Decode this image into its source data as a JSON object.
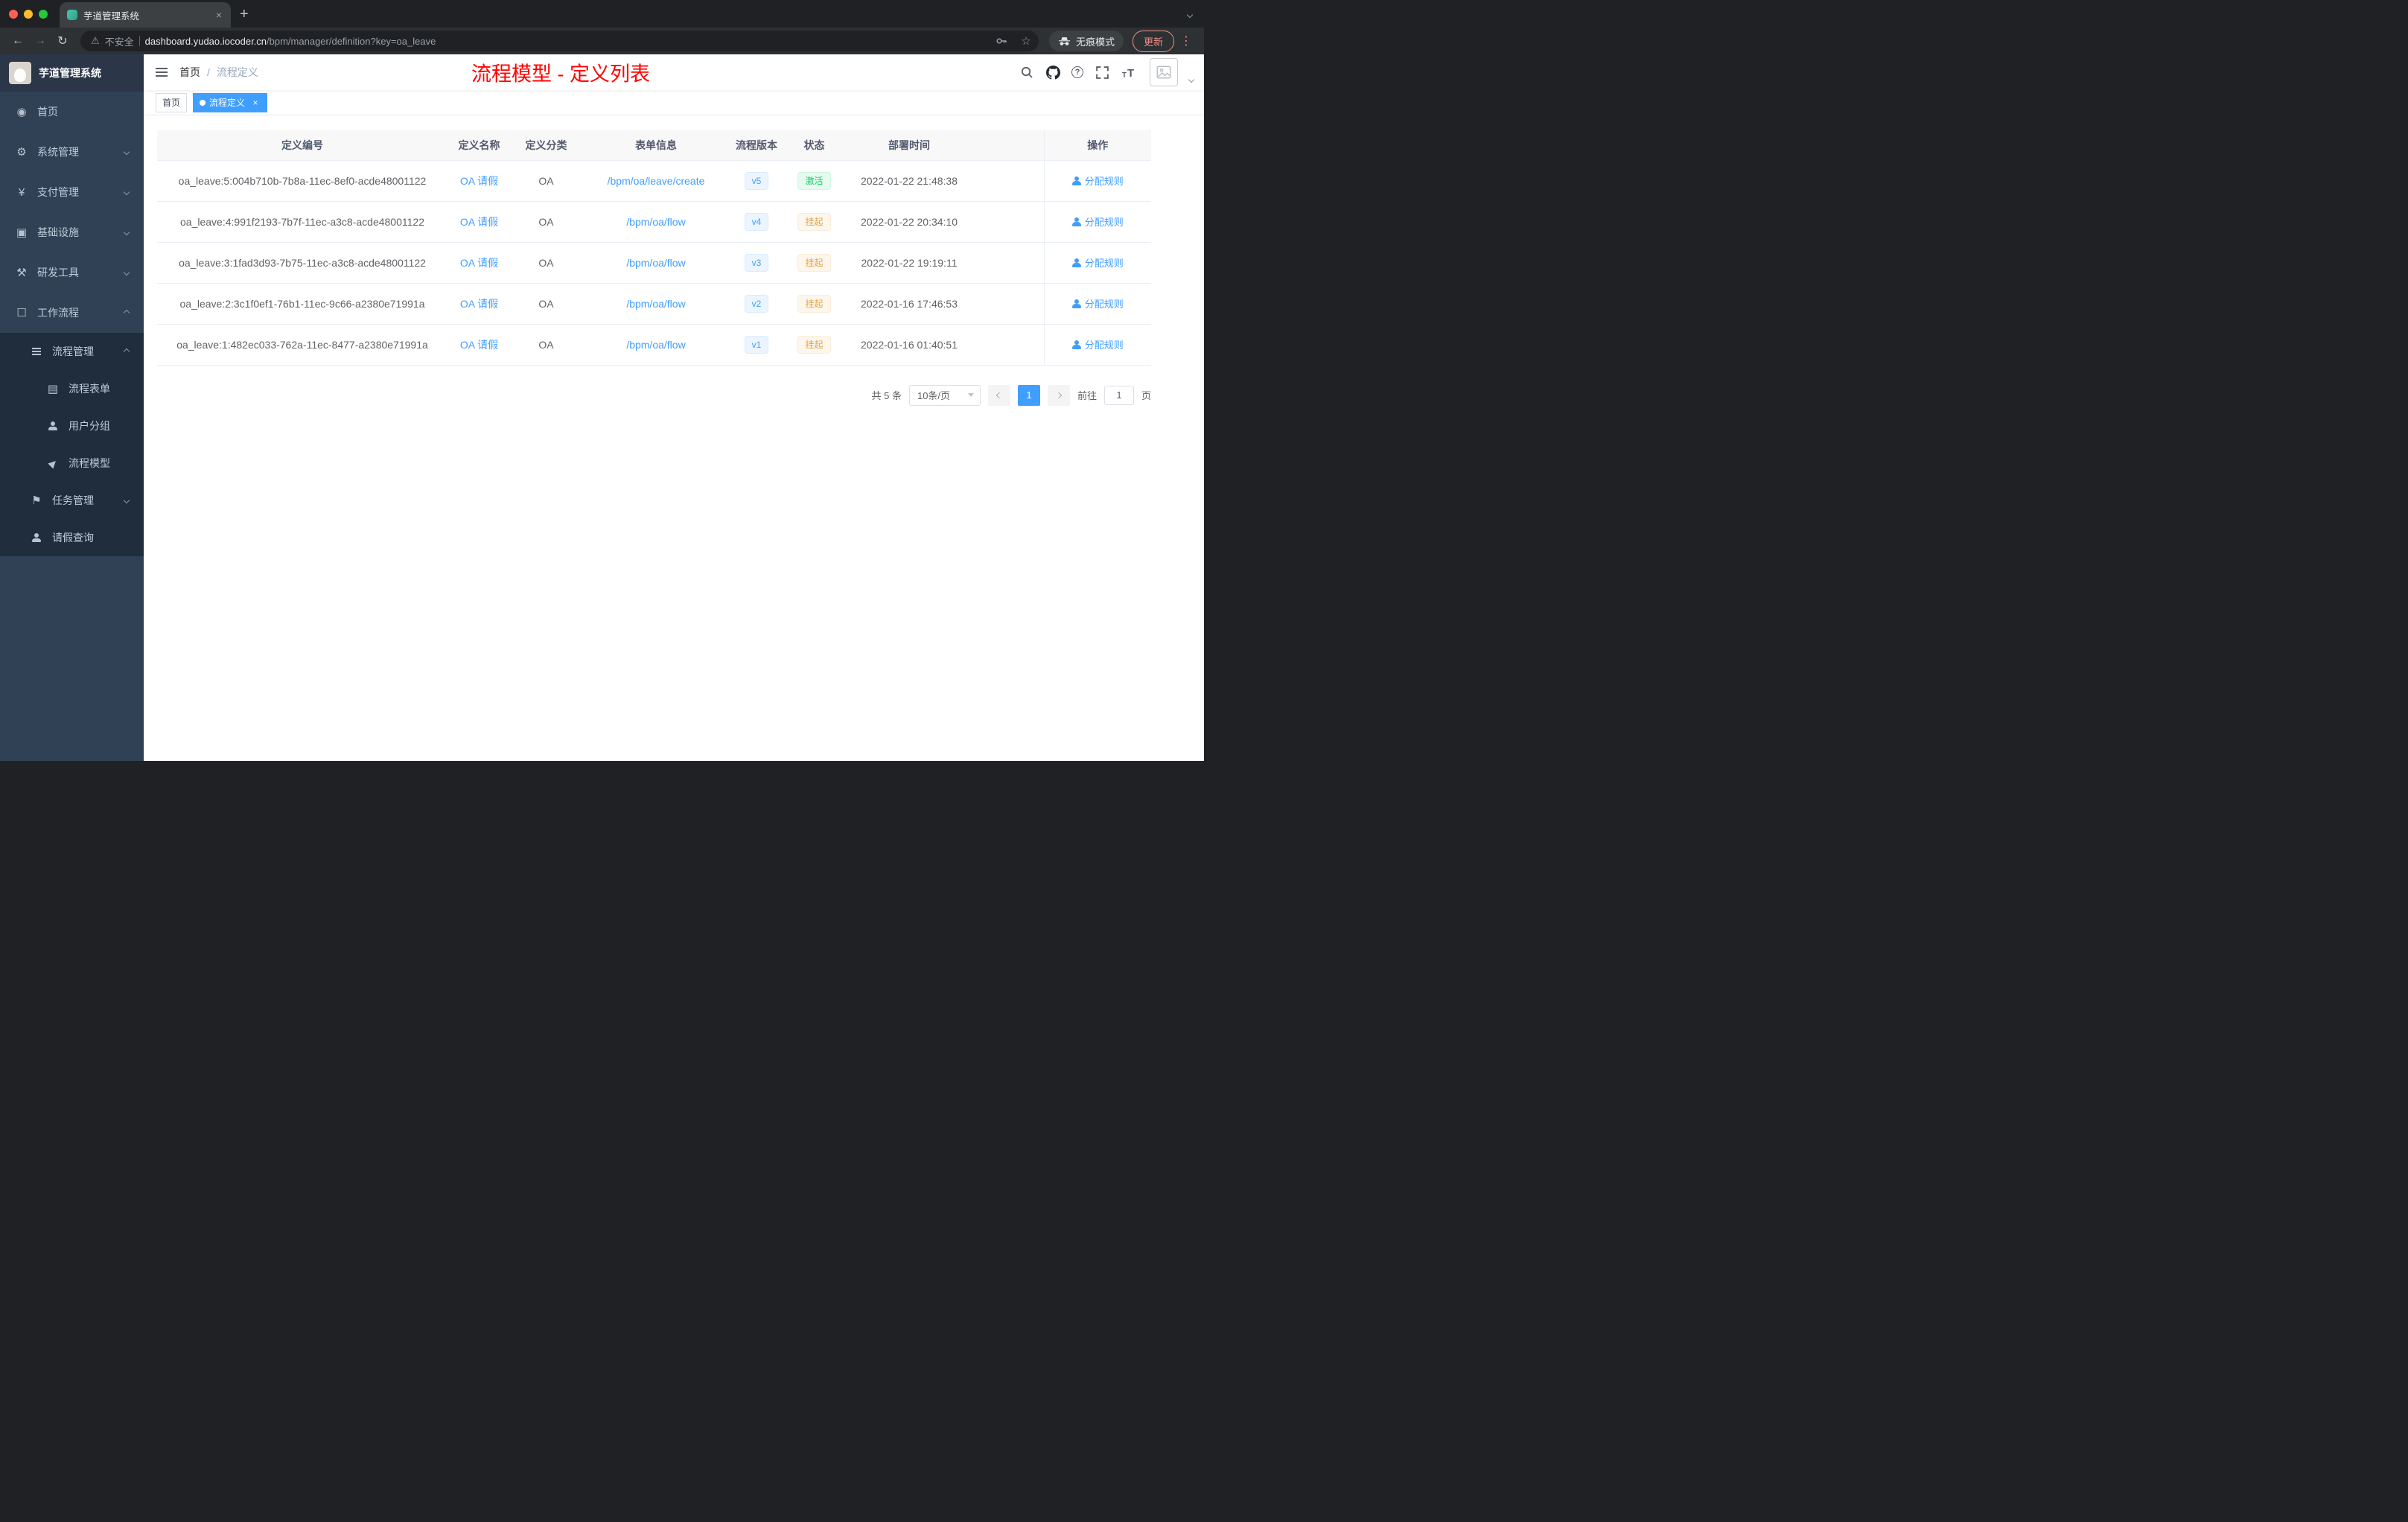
{
  "browser": {
    "tab_title": "芋道管理系统",
    "security_label": "不安全",
    "url_host": "dashboard.yudao.iocoder.cn",
    "url_path": "/bpm/manager/definition?key=oa_leave",
    "incognito_label": "无痕模式",
    "update_label": "更新"
  },
  "glyphs": {
    "back": "←",
    "forward": "→",
    "reload": "↻",
    "warning": "⚠",
    "star": "☆",
    "menu_kebab": "⋮",
    "new_tab": "+",
    "tab_close": "×",
    "tag_close": "×",
    "question": "?",
    "font_t": "T",
    "home": "◉",
    "system": "⚙",
    "payment": "¥",
    "infra": "▣",
    "devtools": "⚒",
    "workflow": "☐",
    "process_form": "▤",
    "process_model": "▶",
    "task": "⚑"
  },
  "sidebar": {
    "logo_title": "芋道管理系统",
    "items": {
      "home": "首页",
      "system": "系统管理",
      "payment": "支付管理",
      "infra": "基础设施",
      "devtools": "研发工具",
      "workflow": "工作流程",
      "process_mgmt": "流程管理",
      "process_form": "流程表单",
      "user_group": "用户分组",
      "process_model": "流程模型",
      "task_mgmt": "任务管理",
      "leave_query": "请假查询"
    }
  },
  "header": {
    "breadcrumb": {
      "home": "首页",
      "separator": "/",
      "current": "流程定义"
    },
    "page_title": "流程模型 - 定义列表"
  },
  "tags": {
    "home": "首页",
    "active": "流程定义"
  },
  "table": {
    "headers": [
      "定义编号",
      "定义名称",
      "定义分类",
      "表单信息",
      "流程版本",
      "状态",
      "部署时间",
      "操作"
    ],
    "rows": [
      {
        "id": "oa_leave:5:004b710b-7b8a-11ec-8ef0-acde48001122",
        "name": "OA 请假",
        "category": "OA",
        "form": "/bpm/oa/leave/create",
        "version": "v5",
        "status": {
          "label": "激活",
          "type": "success"
        },
        "deployed_at": "2022-01-22 21:48:38",
        "action": "分配规则"
      },
      {
        "id": "oa_leave:4:991f2193-7b7f-11ec-a3c8-acde48001122",
        "name": "OA 请假",
        "category": "OA",
        "form": "/bpm/oa/flow",
        "version": "v4",
        "status": {
          "label": "挂起",
          "type": "warning"
        },
        "deployed_at": "2022-01-22 20:34:10",
        "action": "分配规则"
      },
      {
        "id": "oa_leave:3:1fad3d93-7b75-11ec-a3c8-acde48001122",
        "name": "OA 请假",
        "category": "OA",
        "form": "/bpm/oa/flow",
        "version": "v3",
        "status": {
          "label": "挂起",
          "type": "warning"
        },
        "deployed_at": "2022-01-22 19:19:11",
        "action": "分配规则"
      },
      {
        "id": "oa_leave:2:3c1f0ef1-76b1-11ec-9c66-a2380e71991a",
        "name": "OA 请假",
        "category": "OA",
        "form": "/bpm/oa/flow",
        "version": "v2",
        "status": {
          "label": "挂起",
          "type": "warning"
        },
        "deployed_at": "2022-01-16 17:46:53",
        "action": "分配规则"
      },
      {
        "id": "oa_leave:1:482ec033-762a-11ec-8477-a2380e71991a",
        "name": "OA 请假",
        "category": "OA",
        "form": "/bpm/oa/flow",
        "version": "v1",
        "status": {
          "label": "挂起",
          "type": "warning"
        },
        "deployed_at": "2022-01-16 01:40:51",
        "action": "分配规则"
      }
    ]
  },
  "pagination": {
    "total": "共 5 条",
    "page_size": "10条/页",
    "current_page": "1",
    "goto_label": "前往",
    "goto_value": "1",
    "page_unit": "页"
  },
  "colors": {
    "accent": "#409eff",
    "page_title_red": "#ff0000",
    "status_active_green": "#13ce66",
    "status_suspend_orange": "#e6a23c",
    "sidebar_bg": "#304156",
    "submenu_bg": "#1f2d3d"
  }
}
